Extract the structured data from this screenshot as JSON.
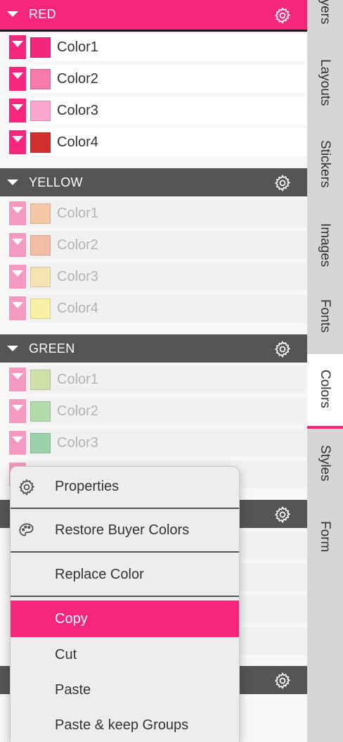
{
  "colors": {
    "accent": "#f5267c",
    "header_dark": "#555555",
    "accent_light": "#f49ac1"
  },
  "groups": [
    {
      "name": "RED",
      "active": true,
      "items": [
        {
          "label": "Color1",
          "swatch": "#f2267c"
        },
        {
          "label": "Color2",
          "swatch": "#f77aab"
        },
        {
          "label": "Color3",
          "swatch": "#fba6cc"
        },
        {
          "label": "Color4",
          "swatch": "#d22f2f"
        }
      ]
    },
    {
      "name": "YELLOW",
      "active": false,
      "items": [
        {
          "label": "Color1",
          "swatch": "#f7c09a"
        },
        {
          "label": "Color2",
          "swatch": "#f4b496"
        },
        {
          "label": "Color3",
          "swatch": "#f6e2a6"
        },
        {
          "label": "Color4",
          "swatch": "#f7ef98"
        }
      ]
    },
    {
      "name": "GREEN",
      "active": false,
      "items": [
        {
          "label": "Color1",
          "swatch": "#c7de9c"
        },
        {
          "label": "Color2",
          "swatch": "#a6d89c"
        },
        {
          "label": "Color3",
          "swatch": "#8ecca0"
        }
      ]
    }
  ],
  "side_tabs": [
    "ayers",
    "Layouts",
    "Stickers",
    "Images",
    "Fonts",
    "Colors",
    "Styles",
    "Form"
  ],
  "active_side_tab": "Colors",
  "context_menu": {
    "properties": "Properties",
    "restore": "Restore Buyer Colors",
    "replace": "Replace Color",
    "copy": "Copy",
    "cut": "Cut",
    "paste": "Paste",
    "paste_keep": "Paste & keep Groups"
  }
}
